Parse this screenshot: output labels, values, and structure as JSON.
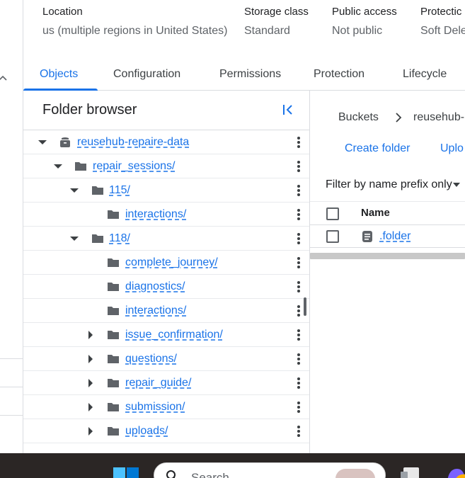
{
  "summary": {
    "location": {
      "label": "Location",
      "value": "us (multiple regions in United States)"
    },
    "storage_class": {
      "label": "Storage class",
      "value": "Standard"
    },
    "public_access": {
      "label": "Public access",
      "value": "Not public"
    },
    "protection": {
      "label": "Protectic",
      "value": "Soft Dele"
    }
  },
  "tabs": [
    {
      "label": "Objects",
      "active": true
    },
    {
      "label": "Configuration",
      "active": false
    },
    {
      "label": "Permissions",
      "active": false
    },
    {
      "label": "Protection",
      "active": false
    },
    {
      "label": "Lifecycle",
      "active": false
    }
  ],
  "folder_browser": {
    "title": "Folder browser",
    "rows": [
      {
        "label": "reusehub-repaire-data",
        "kind": "bucket",
        "expanded": true
      },
      {
        "label": "repair_sessions/",
        "kind": "folder",
        "expanded": true
      },
      {
        "label": "115/",
        "kind": "folder",
        "expanded": true
      },
      {
        "label": "interactions/",
        "kind": "folder"
      },
      {
        "label": "118/",
        "kind": "folder",
        "expanded": true
      },
      {
        "label": "complete_journey/",
        "kind": "folder"
      },
      {
        "label": "diagnostics/",
        "kind": "folder"
      },
      {
        "label": "interactions/",
        "kind": "folder"
      },
      {
        "label": "issue_confirmation/",
        "kind": "folder",
        "expanded": false
      },
      {
        "label": "questions/",
        "kind": "folder",
        "expanded": false
      },
      {
        "label": "repair_guide/",
        "kind": "folder",
        "expanded": false
      },
      {
        "label": "submission/",
        "kind": "folder",
        "expanded": false
      },
      {
        "label": "uploads/",
        "kind": "folder",
        "expanded": false
      }
    ]
  },
  "details": {
    "breadcrumb_root": "Buckets",
    "breadcrumb_bucket": "reusehub-",
    "create_folder": "Create folder",
    "upload": "Uplo",
    "filter": "Filter by name prefix only",
    "name_header": "Name",
    "files": [
      {
        "name": ".folder"
      }
    ]
  },
  "taskbar": {
    "search_placeholder": "Search"
  },
  "colors": {
    "accent": "#1a73e8",
    "taskbar": "#2b2625"
  }
}
